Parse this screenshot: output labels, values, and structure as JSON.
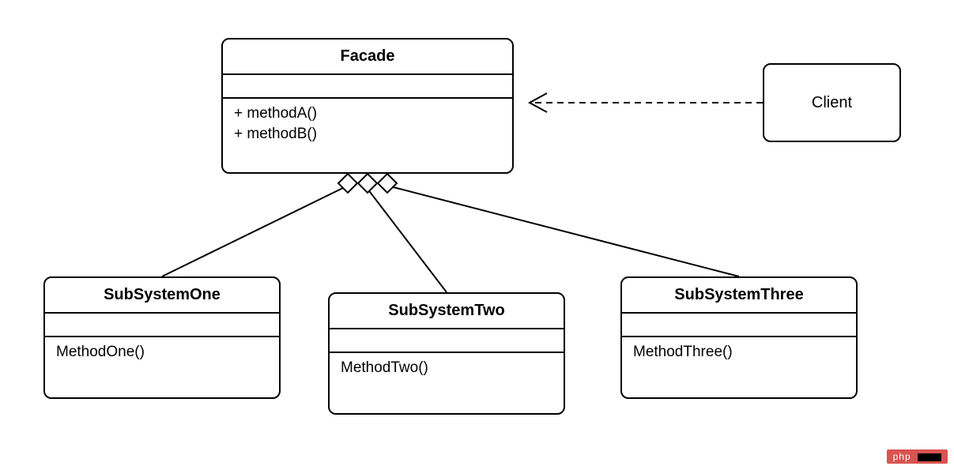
{
  "diagram": {
    "facade": {
      "name": "Facade",
      "methods": [
        "+ methodA()",
        "+ methodB()"
      ]
    },
    "client": {
      "name": "Client"
    },
    "subsystems": [
      {
        "name": "SubSystemOne",
        "method": "MethodOne()"
      },
      {
        "name": "SubSystemTwo",
        "method": "MethodTwo()"
      },
      {
        "name": "SubSystemThree",
        "method": "MethodThree()"
      }
    ],
    "relations": {
      "client_to_facade": "dependency",
      "facade_to_subsystems": "aggregation"
    }
  },
  "watermark": {
    "label": "php"
  }
}
